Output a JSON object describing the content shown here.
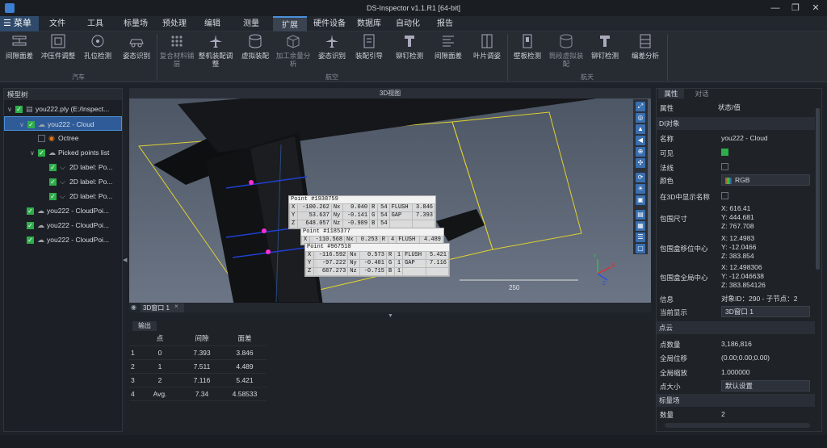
{
  "window": {
    "title": "DS-Inspector v1.1.R1 [64-bit]"
  },
  "menu": {
    "main": "☰ 菜单",
    "tabs": [
      "文件",
      "工具",
      "标量场",
      "预处理",
      "编辑",
      "测量",
      "扩展",
      "硬件设备",
      "数据库",
      "自动化",
      "报告"
    ],
    "active_tab": "扩展"
  },
  "ribbon": {
    "groups": [
      {
        "label": "汽车",
        "buttons": [
          "间隙面差",
          "冲压件调整",
          "孔位检测",
          "姿态识别"
        ]
      },
      {
        "label": "航空",
        "buttons": [
          "复合材料铺层",
          "整机装配调整",
          "虚拟装配",
          "加工余量分析",
          "姿态识别",
          "装配引导",
          "铆钉检测",
          "间隙面差",
          "叶片调姿"
        ]
      },
      {
        "label": "航天",
        "buttons": [
          "壁板检测",
          "筒段虚拟装配",
          "铆钉检测",
          "编差分析"
        ]
      }
    ]
  },
  "tree": {
    "title": "模型树",
    "items": [
      {
        "label": "you222.ply (E:/Inspect...",
        "level": 0,
        "checked": true
      },
      {
        "label": "you222 - Cloud",
        "level": 1,
        "checked": true,
        "selected": true
      },
      {
        "label": "Octree",
        "level": 2,
        "checked": false
      },
      {
        "label": "Picked points list",
        "level": 2,
        "checked": true
      },
      {
        "label": "2D label: Po...",
        "level": 3,
        "checked": true
      },
      {
        "label": "2D label: Po...",
        "level": 3,
        "checked": true
      },
      {
        "label": "2D label: Po...",
        "level": 3,
        "checked": true
      },
      {
        "label": "you222 - CloudPoi...",
        "level": 1,
        "checked": true
      },
      {
        "label": "you222 - CloudPoi...",
        "level": 1,
        "checked": true
      },
      {
        "label": "you222 - CloudPoi...",
        "level": 1,
        "checked": true
      }
    ]
  },
  "viewport": {
    "title": "3D视图",
    "tab": "3D窗口 1",
    "scale_label": "250",
    "labels": [
      {
        "title": "Point #1938759",
        "rows": [
          [
            "X",
            "-100.262",
            "Nx",
            "0.040",
            "R",
            "54",
            "FLUSH",
            "3.846"
          ],
          [
            "Y",
            "53.637",
            "Ny",
            "-0.141",
            "G",
            "54",
            "GAP",
            "7.393"
          ],
          [
            "Z",
            "648.057",
            "Nz",
            "-0.989",
            "B",
            "54",
            "",
            ""
          ]
        ]
      },
      {
        "title": "Point #1185377",
        "rows": [
          [
            "X",
            "-110.568",
            "Nx",
            "0.253",
            "R",
            "4",
            "FLUSH",
            "4.489"
          ]
        ]
      },
      {
        "title": "Point #967510",
        "rows": [
          [
            "X",
            "-116.592",
            "Nx",
            "0.573",
            "R",
            "1",
            "FLUSH",
            "5.421"
          ],
          [
            "Y",
            "-97.222",
            "Ny",
            "-0.401",
            "G",
            "1",
            "GAP",
            "7.116"
          ],
          [
            "Z",
            "687.273",
            "Nz",
            "-0.715",
            "B",
            "1",
            "",
            ""
          ]
        ]
      }
    ]
  },
  "output": {
    "title": "输出",
    "headers": [
      "",
      "点",
      "间隙",
      "面差"
    ],
    "rows": [
      [
        "1",
        "0",
        "7.393",
        "3.846"
      ],
      [
        "2",
        "1",
        "7.511",
        "4.489"
      ],
      [
        "3",
        "2",
        "7.116",
        "5.421"
      ],
      [
        "4",
        "Avg.",
        "7.34",
        "4.58533"
      ]
    ]
  },
  "props": {
    "tabs": [
      "属性",
      "对话"
    ],
    "header_key": "属性",
    "header_val": "状态/值",
    "section_di": "DI对象",
    "name_k": "名称",
    "name_v": "you222 - Cloud",
    "visible_k": "可见",
    "normal_k": "法线",
    "color_k": "颜色",
    "color_v": "RGB",
    "show3d_k": "在3D中显示名称",
    "bbox_k": "包围尺寸",
    "bbox_x": "X: 616.41",
    "bbox_y": "Y: 444.681",
    "bbox_z": "Z: 767.708",
    "lc_k": "包围盒移位中心",
    "lc_x": "X: 12.4983",
    "lc_y": "Y: -12.0466",
    "lc_z": "Z: 383.854",
    "gc_k": "包围盒全局中心",
    "gc_x": "X: 12.498306",
    "gc_y": "Y: -12.046638",
    "gc_z": "Z: 383.854126",
    "info_k": "信息",
    "info_v": "对象ID：290 - 子节点：2",
    "disp_k": "当前显示",
    "disp_v": "3D窗口 1",
    "section_pc": "点云",
    "pts_k": "点数量",
    "pts_v": "3,186,816",
    "gshift_k": "全局位移",
    "gshift_v": "(0.00;0.00;0.00)",
    "gscale_k": "全局缩放",
    "gscale_v": "1.000000",
    "psize_k": "点大小",
    "psize_v": "默认设置",
    "section_sf": "标量场",
    "sfcount_k": "数量",
    "sfcount_v": "2"
  },
  "colors": {
    "accent": "#4a90d9",
    "check": "#2eae4a",
    "marker": "#ff2bd6"
  }
}
